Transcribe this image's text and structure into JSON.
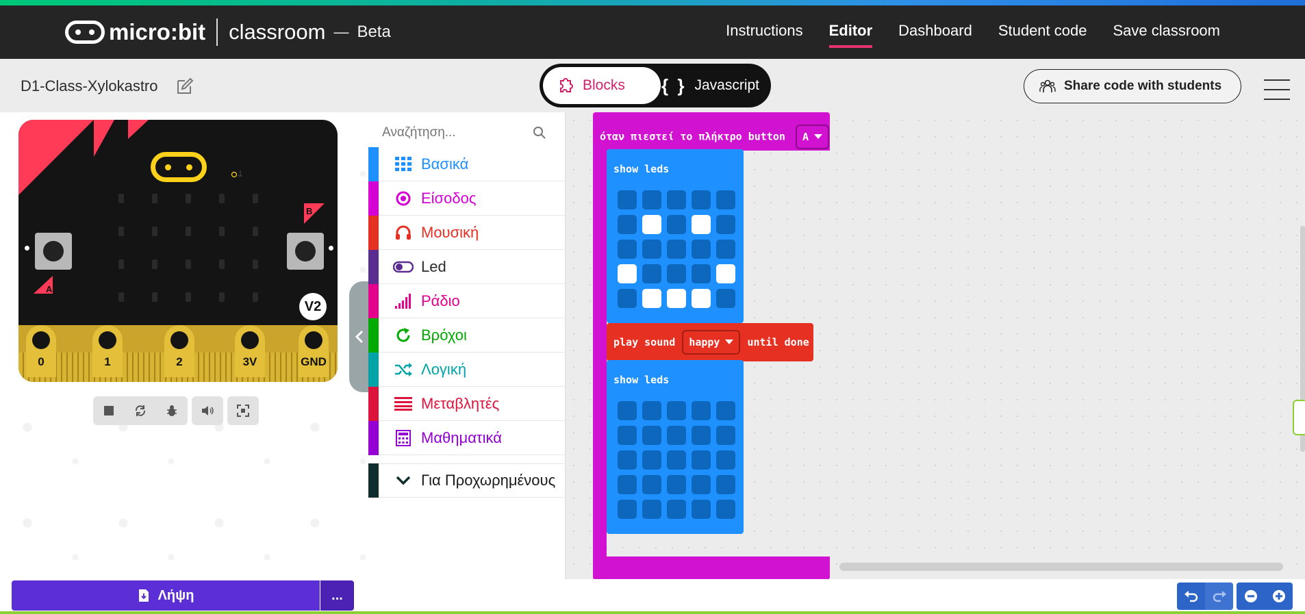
{
  "header": {
    "logo_text": "micro:bit",
    "product": "classroom",
    "dash": "—",
    "beta": "Beta",
    "nav": [
      {
        "label": "Instructions"
      },
      {
        "label": "Editor"
      },
      {
        "label": "Dashboard"
      },
      {
        "label": "Student code"
      },
      {
        "label": "Save classroom"
      }
    ]
  },
  "toolbar": {
    "project_name": "D1-Class-Xylokastro",
    "toggle_blocks": "Blocks",
    "toggle_braces": "{ }",
    "toggle_js": "Javascript",
    "share_label": "Share code with students"
  },
  "simulator": {
    "button_a": "A",
    "button_b": "B",
    "version_badge": "V2",
    "pins": [
      "0",
      "1",
      "2",
      "3V",
      "GND"
    ]
  },
  "toolbox": {
    "search_placeholder": "Αναζήτηση...",
    "categories": [
      {
        "label": "Βασικά",
        "color": "#1e90ff",
        "icon": "grid-icon"
      },
      {
        "label": "Είσοδος",
        "color": "#d400d4",
        "icon": "target-icon"
      },
      {
        "label": "Μουσική",
        "color": "#e63022",
        "icon": "headphones-icon"
      },
      {
        "label": "Led",
        "color": "#5c2d91",
        "icon": "toggle-icon"
      },
      {
        "label": "Ράδιο",
        "color": "#e3008c",
        "icon": "signal-icon"
      },
      {
        "label": "Βρόχοι",
        "color": "#00aa00",
        "icon": "refresh-icon"
      },
      {
        "label": "Λογική",
        "color": "#00a4a6",
        "icon": "shuffle-icon"
      },
      {
        "label": "Μεταβλητές",
        "color": "#dc143c",
        "icon": "lines-icon"
      },
      {
        "label": "Μαθηματικά",
        "color": "#9400d3",
        "icon": "calculator-icon"
      },
      {
        "label": "Για Προχωρημένους",
        "color": "#0f2f2f",
        "icon": "chevron-down-icon"
      }
    ]
  },
  "workspace": {
    "event_label": "όταν πιεστεί το πλήκτρο button",
    "event_button": "A",
    "show_leds_1": "show leds",
    "show_leds_2": "show leds",
    "play_sound": "play sound",
    "sound_name": "happy",
    "until_done": "until done"
  },
  "bottom": {
    "download_label": "Λήψη",
    "more_label": "..."
  },
  "colors": {
    "accent": "#e6336e",
    "event_block": "#d112d1",
    "basic_block": "#1e90ff",
    "music_block": "#e63022",
    "download": "#5c2fd6"
  }
}
